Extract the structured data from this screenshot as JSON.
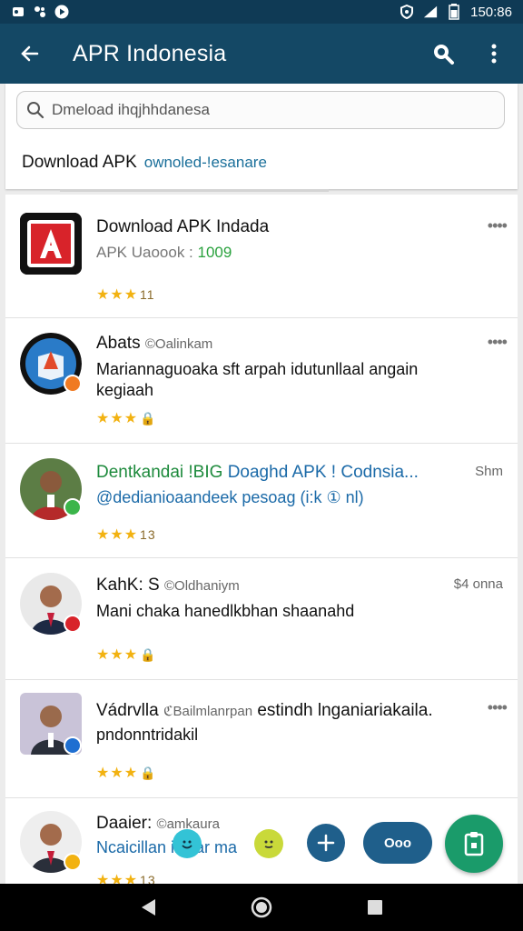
{
  "status_bar": {
    "time": "150:86",
    "left_icons": [
      "notification-icon",
      "notification-icon",
      "play-icon"
    ],
    "right_icons": [
      "shield-icon",
      "signal-icon",
      "battery-icon"
    ]
  },
  "app_bar": {
    "title": "APR Indonesia",
    "actions": [
      "search-icon",
      "more-vert-icon"
    ]
  },
  "search": {
    "placeholder": "Dmeload ihqjhhdanesa"
  },
  "breadcrumb": {
    "label": "Download APK",
    "link": "ownoled-!esanare"
  },
  "rows": [
    {
      "title": "Download APK Indada",
      "subtitle": "APK Uaoook :",
      "count": "1009",
      "stars": "★★★",
      "extra": "11",
      "more": "••••"
    },
    {
      "title": "Abats",
      "meta": "©Oalinkam",
      "body": "Mariannaguoaka sft arpah idutunllaal angain kegiaah",
      "stars": "★★★",
      "extra": "🔒",
      "more": "••••"
    },
    {
      "title_green": "Dentkandai !BIG",
      "title_blue": "Doaghd APK ! Codnsia...",
      "body": "@dedianioaandeek pesoag (i:k ① nl)",
      "time": "Shm",
      "stars": "★★★",
      "extra": "13"
    },
    {
      "title": "KahK: S",
      "meta": "©Oldhaniym",
      "body": "Mani chaka hanedlkbhan shaanahd",
      "time": "$4 onna",
      "stars": "★★★",
      "extra": "🔒"
    },
    {
      "title": "Vádrvlla",
      "meta": "ℭBailmlanrpan",
      "title_rest": "estindh lnganiariakaila.",
      "body": "pndonntridakil",
      "stars": "★★★",
      "extra": "🔒",
      "more": "••••"
    },
    {
      "title": "Daaier:",
      "meta": "©amkaura",
      "body": "Ncaicillan",
      "body_rest": "ir Bar ma",
      "stars": "★★★",
      "extra": "13"
    }
  ],
  "fab": {
    "pill_label": "Ooo"
  },
  "colors": {
    "app_bar": "#144865",
    "status_bar": "#0f3a55",
    "accent_green": "#1a9b6a",
    "accent_blue": "#1f5f8b"
  }
}
